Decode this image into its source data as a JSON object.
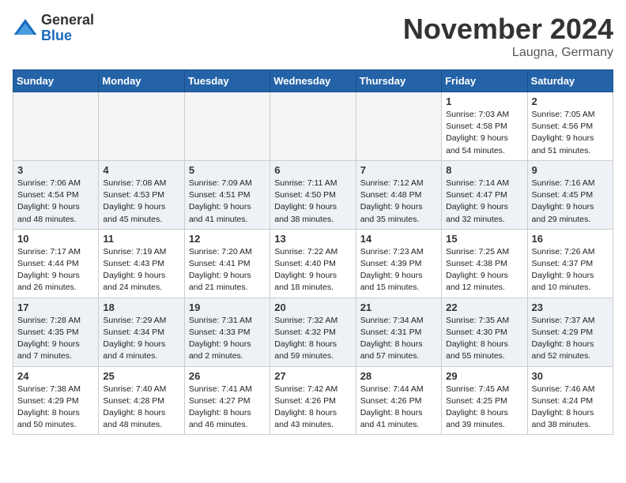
{
  "logo": {
    "general": "General",
    "blue": "Blue"
  },
  "title": "November 2024",
  "location": "Laugna, Germany",
  "days_header": [
    "Sunday",
    "Monday",
    "Tuesday",
    "Wednesday",
    "Thursday",
    "Friday",
    "Saturday"
  ],
  "weeks": [
    [
      {
        "day": "",
        "info": ""
      },
      {
        "day": "",
        "info": ""
      },
      {
        "day": "",
        "info": ""
      },
      {
        "day": "",
        "info": ""
      },
      {
        "day": "",
        "info": ""
      },
      {
        "day": "1",
        "info": "Sunrise: 7:03 AM\nSunset: 4:58 PM\nDaylight: 9 hours\nand 54 minutes."
      },
      {
        "day": "2",
        "info": "Sunrise: 7:05 AM\nSunset: 4:56 PM\nDaylight: 9 hours\nand 51 minutes."
      }
    ],
    [
      {
        "day": "3",
        "info": "Sunrise: 7:06 AM\nSunset: 4:54 PM\nDaylight: 9 hours\nand 48 minutes."
      },
      {
        "day": "4",
        "info": "Sunrise: 7:08 AM\nSunset: 4:53 PM\nDaylight: 9 hours\nand 45 minutes."
      },
      {
        "day": "5",
        "info": "Sunrise: 7:09 AM\nSunset: 4:51 PM\nDaylight: 9 hours\nand 41 minutes."
      },
      {
        "day": "6",
        "info": "Sunrise: 7:11 AM\nSunset: 4:50 PM\nDaylight: 9 hours\nand 38 minutes."
      },
      {
        "day": "7",
        "info": "Sunrise: 7:12 AM\nSunset: 4:48 PM\nDaylight: 9 hours\nand 35 minutes."
      },
      {
        "day": "8",
        "info": "Sunrise: 7:14 AM\nSunset: 4:47 PM\nDaylight: 9 hours\nand 32 minutes."
      },
      {
        "day": "9",
        "info": "Sunrise: 7:16 AM\nSunset: 4:45 PM\nDaylight: 9 hours\nand 29 minutes."
      }
    ],
    [
      {
        "day": "10",
        "info": "Sunrise: 7:17 AM\nSunset: 4:44 PM\nDaylight: 9 hours\nand 26 minutes."
      },
      {
        "day": "11",
        "info": "Sunrise: 7:19 AM\nSunset: 4:43 PM\nDaylight: 9 hours\nand 24 minutes."
      },
      {
        "day": "12",
        "info": "Sunrise: 7:20 AM\nSunset: 4:41 PM\nDaylight: 9 hours\nand 21 minutes."
      },
      {
        "day": "13",
        "info": "Sunrise: 7:22 AM\nSunset: 4:40 PM\nDaylight: 9 hours\nand 18 minutes."
      },
      {
        "day": "14",
        "info": "Sunrise: 7:23 AM\nSunset: 4:39 PM\nDaylight: 9 hours\nand 15 minutes."
      },
      {
        "day": "15",
        "info": "Sunrise: 7:25 AM\nSunset: 4:38 PM\nDaylight: 9 hours\nand 12 minutes."
      },
      {
        "day": "16",
        "info": "Sunrise: 7:26 AM\nSunset: 4:37 PM\nDaylight: 9 hours\nand 10 minutes."
      }
    ],
    [
      {
        "day": "17",
        "info": "Sunrise: 7:28 AM\nSunset: 4:35 PM\nDaylight: 9 hours\nand 7 minutes."
      },
      {
        "day": "18",
        "info": "Sunrise: 7:29 AM\nSunset: 4:34 PM\nDaylight: 9 hours\nand 4 minutes."
      },
      {
        "day": "19",
        "info": "Sunrise: 7:31 AM\nSunset: 4:33 PM\nDaylight: 9 hours\nand 2 minutes."
      },
      {
        "day": "20",
        "info": "Sunrise: 7:32 AM\nSunset: 4:32 PM\nDaylight: 8 hours\nand 59 minutes."
      },
      {
        "day": "21",
        "info": "Sunrise: 7:34 AM\nSunset: 4:31 PM\nDaylight: 8 hours\nand 57 minutes."
      },
      {
        "day": "22",
        "info": "Sunrise: 7:35 AM\nSunset: 4:30 PM\nDaylight: 8 hours\nand 55 minutes."
      },
      {
        "day": "23",
        "info": "Sunrise: 7:37 AM\nSunset: 4:29 PM\nDaylight: 8 hours\nand 52 minutes."
      }
    ],
    [
      {
        "day": "24",
        "info": "Sunrise: 7:38 AM\nSunset: 4:29 PM\nDaylight: 8 hours\nand 50 minutes."
      },
      {
        "day": "25",
        "info": "Sunrise: 7:40 AM\nSunset: 4:28 PM\nDaylight: 8 hours\nand 48 minutes."
      },
      {
        "day": "26",
        "info": "Sunrise: 7:41 AM\nSunset: 4:27 PM\nDaylight: 8 hours\nand 46 minutes."
      },
      {
        "day": "27",
        "info": "Sunrise: 7:42 AM\nSunset: 4:26 PM\nDaylight: 8 hours\nand 43 minutes."
      },
      {
        "day": "28",
        "info": "Sunrise: 7:44 AM\nSunset: 4:26 PM\nDaylight: 8 hours\nand 41 minutes."
      },
      {
        "day": "29",
        "info": "Sunrise: 7:45 AM\nSunset: 4:25 PM\nDaylight: 8 hours\nand 39 minutes."
      },
      {
        "day": "30",
        "info": "Sunrise: 7:46 AM\nSunset: 4:24 PM\nDaylight: 8 hours\nand 38 minutes."
      }
    ]
  ]
}
